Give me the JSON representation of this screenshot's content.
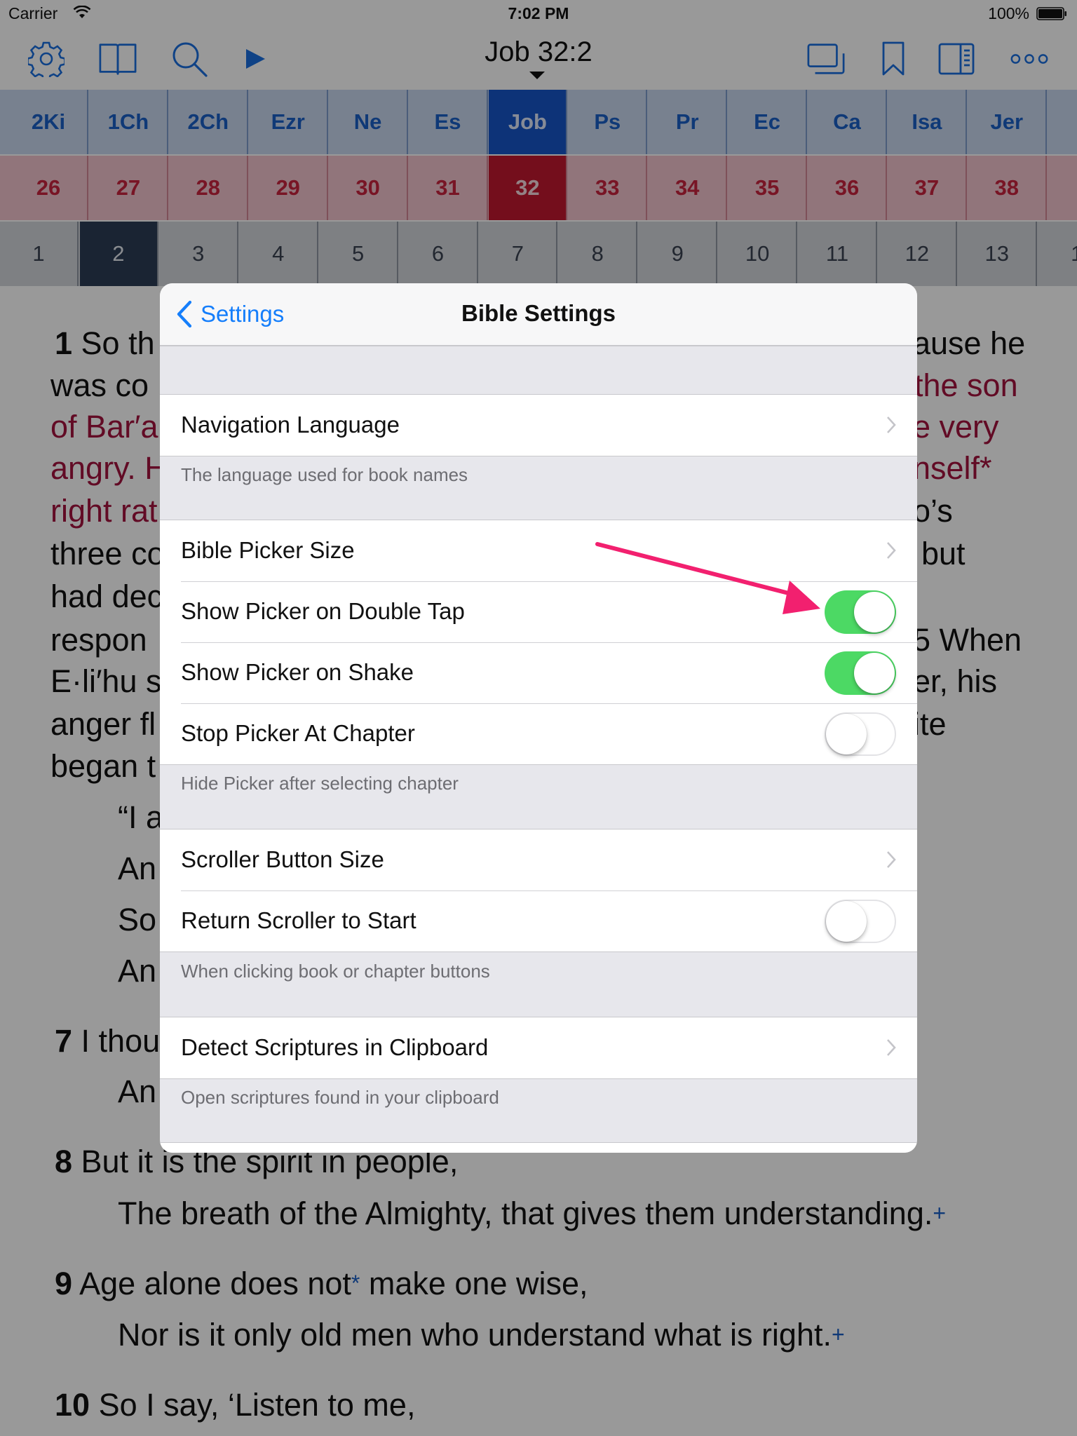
{
  "status_bar": {
    "carrier": "Carrier",
    "time": "7:02 PM",
    "battery": "100%"
  },
  "toolbar": {
    "left_icons": [
      "gear-icon",
      "book-icon",
      "search-icon",
      "play-icon"
    ],
    "reference": "Job 32:2",
    "right_icons": [
      "windows-icon",
      "bookmark-icon",
      "sidebar-icon",
      "more-icon"
    ]
  },
  "books": [
    "2Ki",
    "1Ch",
    "2Ch",
    "Ezr",
    "Ne",
    "Es",
    "Job",
    "Ps",
    "Pr",
    "Ec",
    "Ca",
    "Isa",
    "Jer"
  ],
  "selected_book": "Job",
  "chapters": [
    "26",
    "27",
    "28",
    "29",
    "30",
    "31",
    "32",
    "33",
    "34",
    "35",
    "36",
    "37",
    "38"
  ],
  "selected_chapter": "32",
  "verses": [
    "1",
    "2",
    "3",
    "4",
    "5",
    "6",
    "7",
    "8",
    "9",
    "10",
    "11",
    "12",
    "13",
    "1"
  ],
  "selected_verse": "2",
  "reader": {
    "l1_num": "1",
    "l1_left": "So th",
    "l1_right": "ause he",
    "l2_left": "was co",
    "l2_right": "the son",
    "l3_left": "of Bar′a",
    "l3_right": "e very",
    "l4_left": "angry. H",
    "l4_right": "nself*",
    "l5_left": "right rat",
    "l5_right": "o’s",
    "l6_left": "three co",
    "l6_right": "but",
    "l7_left": "had dec",
    "l8_left": "respon",
    "l8_right": "5 When",
    "l9_left": "E·li′hu s",
    "l9_right": "er, his",
    "l10_left": "anger fl",
    "l10_right": "ite",
    "l11_left": "began t",
    "l12_left": "“I a",
    "l13_left": "An",
    "l14_left": "So",
    "l15_left": "An",
    "l16_num": "7",
    "l16_left": "I thou",
    "l17_left": "An",
    "v8_num": "8",
    "v8_line1": "But it is the spirit in people,",
    "v8_line2": "The breath of the Almighty, that gives them understanding.",
    "v9_num": "9",
    "v9_line1a": "Age alone does not",
    "v9_line1b": "make one wise,",
    "v9_line2": "Nor is it only old men who understand what is right.",
    "v10_num": "10",
    "v10_line1": "So I say, ‘Listen to me,",
    "star": "*",
    "plus": "+"
  },
  "popover": {
    "back_label": "Settings",
    "title": "Bible Settings",
    "navigation_language": "Navigation Language",
    "navigation_language_footer": "The language used for book names",
    "bible_picker_size": "Bible Picker Size",
    "show_picker_double_tap": {
      "label": "Show Picker on Double Tap",
      "on": true
    },
    "show_picker_shake": {
      "label": "Show Picker on Shake",
      "on": true
    },
    "stop_picker_chapter": {
      "label": "Stop Picker At Chapter",
      "on": false
    },
    "picker_footer": "Hide Picker after selecting chapter",
    "scroller_button_size": "Scroller Button Size",
    "return_scroller": {
      "label": "Return Scroller to Start",
      "on": false
    },
    "scroller_footer": "When clicking book or chapter buttons",
    "detect_scriptures": "Detect Scriptures in Clipboard",
    "detect_footer": "Open scriptures found in your clipboard"
  },
  "colors": {
    "accent": "#157efb",
    "switch_on": "#4cd964",
    "annotation_arrow": "#f2206f"
  }
}
